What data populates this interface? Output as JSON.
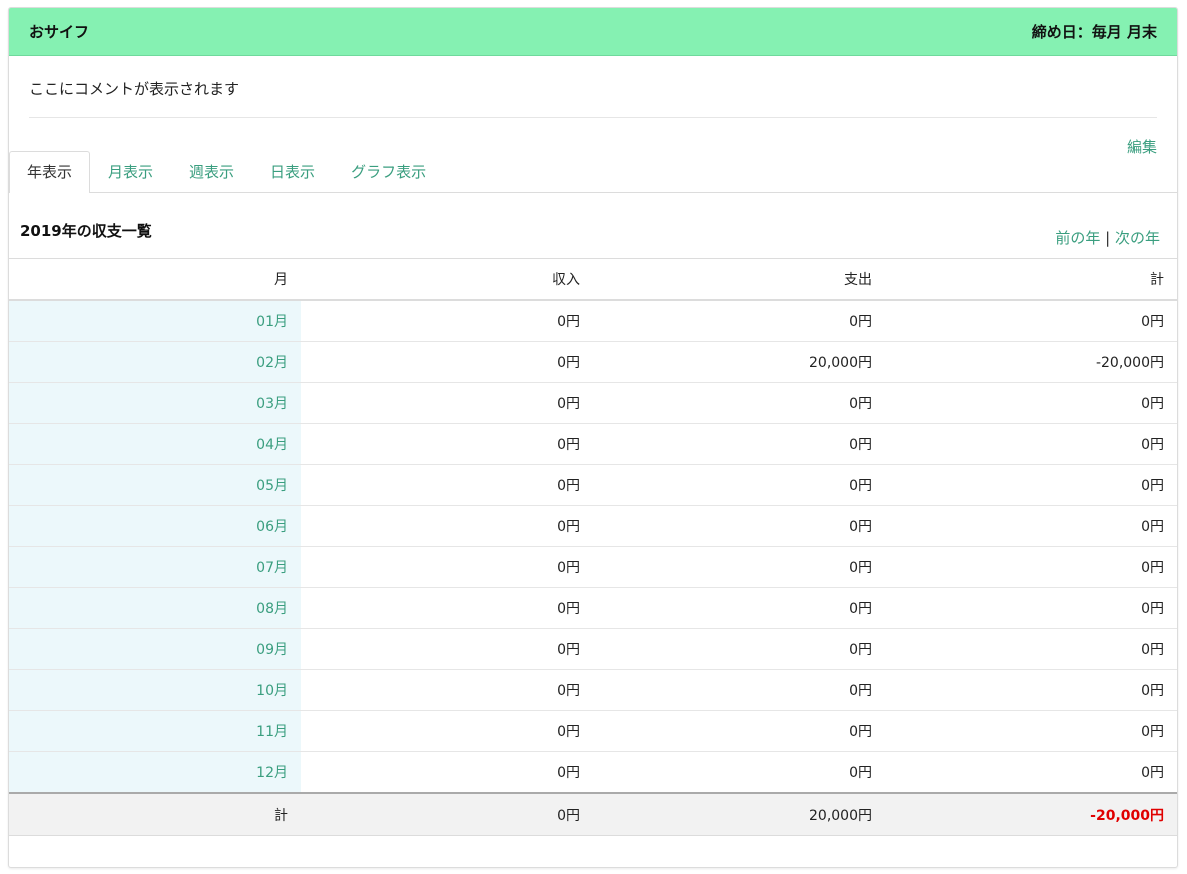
{
  "header": {
    "title": "おサイフ",
    "closing_day": "締め日：毎月 月末"
  },
  "comment": "ここにコメントが表示されます",
  "edit_label": "編集",
  "tabs": [
    {
      "label": "年表示",
      "active": true
    },
    {
      "label": "月表示",
      "active": false
    },
    {
      "label": "週表示",
      "active": false
    },
    {
      "label": "日表示",
      "active": false
    },
    {
      "label": "グラフ表示",
      "active": false
    }
  ],
  "list": {
    "title": "2019年の収支一覧",
    "prev_label": "前の年",
    "separator": "|",
    "next_label": "次の年"
  },
  "table": {
    "columns": [
      "月",
      "収入",
      "支出",
      "計"
    ],
    "rows": [
      {
        "month": "01月",
        "income": "0円",
        "expense": "0円",
        "total": "0円"
      },
      {
        "month": "02月",
        "income": "0円",
        "expense": "20,000円",
        "total": "-20,000円"
      },
      {
        "month": "03月",
        "income": "0円",
        "expense": "0円",
        "total": "0円"
      },
      {
        "month": "04月",
        "income": "0円",
        "expense": "0円",
        "total": "0円"
      },
      {
        "month": "05月",
        "income": "0円",
        "expense": "0円",
        "total": "0円"
      },
      {
        "month": "06月",
        "income": "0円",
        "expense": "0円",
        "total": "0円"
      },
      {
        "month": "07月",
        "income": "0円",
        "expense": "0円",
        "total": "0円"
      },
      {
        "month": "08月",
        "income": "0円",
        "expense": "0円",
        "total": "0円"
      },
      {
        "month": "09月",
        "income": "0円",
        "expense": "0円",
        "total": "0円"
      },
      {
        "month": "10月",
        "income": "0円",
        "expense": "0円",
        "total": "0円"
      },
      {
        "month": "11月",
        "income": "0円",
        "expense": "0円",
        "total": "0円"
      },
      {
        "month": "12月",
        "income": "0円",
        "expense": "0円",
        "total": "0円"
      }
    ],
    "footer": {
      "label": "計",
      "income": "0円",
      "expense": "20,000円",
      "total": "-20,000円"
    }
  },
  "colors": {
    "header_bg": "#85f1b2",
    "link": "#3a9e7f",
    "month_cell_bg": "#ecf8fb",
    "negative_total": "#e00000"
  }
}
